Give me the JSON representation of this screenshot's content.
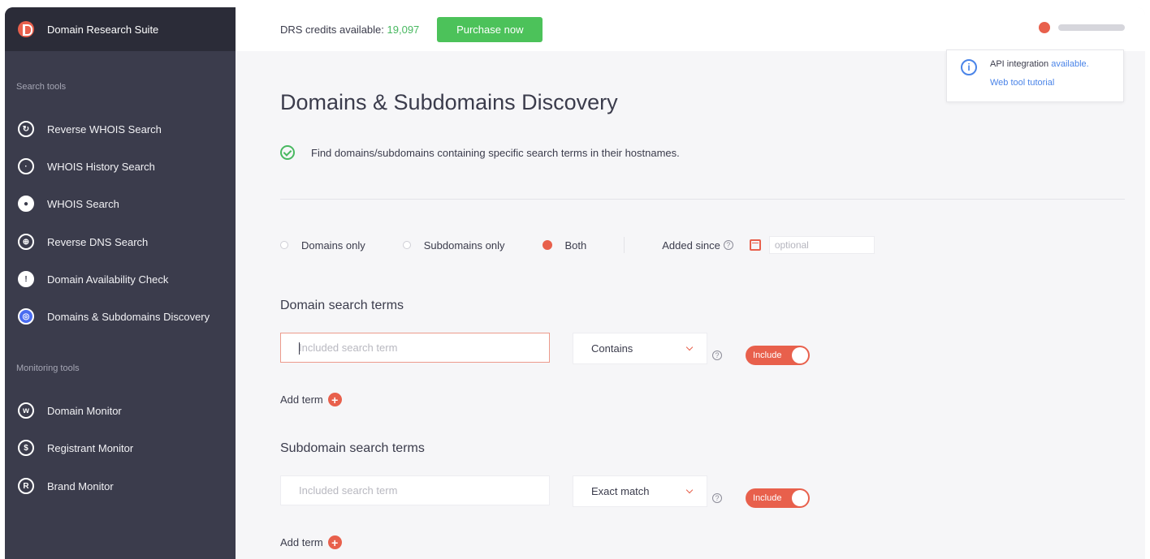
{
  "app": {
    "title": "Domain Research Suite"
  },
  "sidebar": {
    "search_section": "Search tools",
    "search_items": [
      {
        "label": "Reverse WHOIS Search",
        "icon": "reverse-whois-icon"
      },
      {
        "label": "WHOIS History Search",
        "icon": "history-icon"
      },
      {
        "label": "WHOIS Search",
        "icon": "user-circle-icon"
      },
      {
        "label": "Reverse DNS Search",
        "icon": "globe-icon"
      },
      {
        "label": "Domain Availability Check",
        "icon": "availability-icon"
      },
      {
        "label": "Domains & Subdomains Discovery",
        "icon": "discovery-icon",
        "active": true
      }
    ],
    "monitoring_section": "Monitoring tools",
    "monitoring_items": [
      {
        "label": "Domain Monitor",
        "icon": "www-icon"
      },
      {
        "label": "Registrant Monitor",
        "icon": "registrant-icon"
      },
      {
        "label": "Brand Monitor",
        "icon": "brand-icon"
      }
    ]
  },
  "topbar": {
    "credits_label": "DRS credits available:",
    "credits_value": "19,097",
    "purchase_label": "Purchase now"
  },
  "popover": {
    "text": "API integration",
    "link": "available.",
    "tutorial": "Web tool tutorial"
  },
  "main": {
    "title": "Domains & Subdomains Discovery",
    "description": "Find domains/subdomains containing specific search terms in their hostnames.",
    "filters": {
      "domains_only": "Domains only",
      "subdomains_only": "Subdomains only",
      "both": "Both",
      "selected": "Both",
      "added_since": "Added since",
      "date_placeholder": "optional"
    },
    "domain_section": {
      "title": "Domain search terms",
      "placeholder": "Included search term",
      "match": "Contains",
      "toggle": "Include",
      "add_term": "Add term"
    },
    "subdomain_section": {
      "title": "Subdomain search terms",
      "placeholder": "Included search term",
      "match": "Exact match",
      "toggle": "Include",
      "add_term": "Add term"
    }
  },
  "colors": {
    "accent": "#e8604c",
    "green": "#4cc25a",
    "sidebar_bg": "#3b3c4c",
    "link": "#4a84e8"
  }
}
